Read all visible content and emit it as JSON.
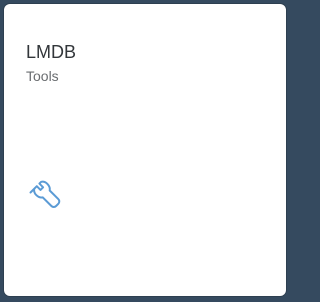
{
  "tile": {
    "title": "LMDB",
    "subtitle": "Tools",
    "icon": "wrench-icon",
    "icon_color": "#5b9bd5"
  }
}
